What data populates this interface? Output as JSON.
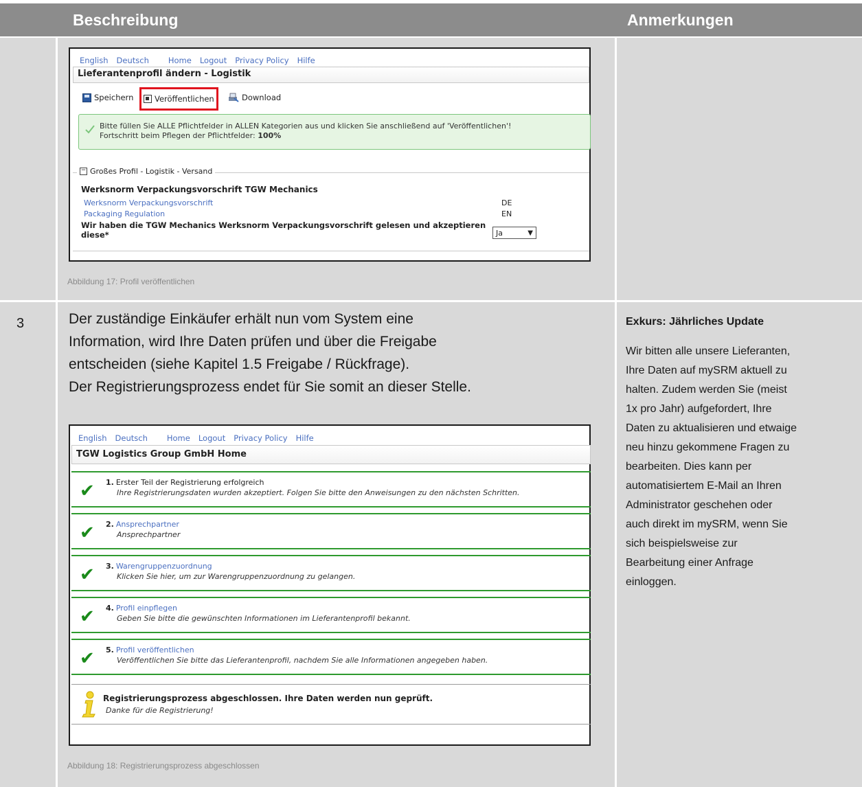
{
  "header": {
    "col_description": "Beschreibung",
    "col_notes": "Anmerkungen"
  },
  "figure17": {
    "nav": [
      "English",
      "Deutsch",
      "Home",
      "Logout",
      "Privacy Policy",
      "Hilfe"
    ],
    "title": "Lieferantenprofil ändern - Logistik",
    "toolbar": {
      "save": "Speichern",
      "publish": "Veröffentlichen",
      "download": "Download"
    },
    "message_line1": "Bitte füllen Sie ALLE Pflichtfelder in ALLEN Kategorien aus und klicken Sie anschließend auf 'Veröffentlichen'!",
    "message_line2_prefix": "Fortschritt beim Pflegen der Pflichtfelder:",
    "message_progress": "100%",
    "section_legend": "Großes Profil - Logistik - Versand",
    "section_title": "Werksnorm Verpackungsvorschrift TGW Mechanics",
    "link1": "Werksnorm Verpackungsvorschrift",
    "link1_lang": "DE",
    "link2": "Packaging Regulation",
    "link2_lang": "EN",
    "question": "Wir haben die TGW Mechanics Werksnorm Verpackungsvorschrift gelesen und akzeptieren diese*",
    "answer": "Ja",
    "caption": "Abbildung 17: Profil veröffentlichen"
  },
  "row3": {
    "number": "3",
    "text_line1": "Der zuständige Einkäufer erhält nun vom System eine",
    "text_line2": "Information, wird Ihre Daten prüfen und über die Freigabe",
    "text_line3": "entscheiden (siehe Kapitel 1.5 Freigabe / Rückfrage).",
    "text_line4": "Der Registrierungsprozess endet für Sie somit an dieser Stelle.",
    "note_title": "Exkurs: Jährliches Update",
    "note_lines": [
      "Wir bitten alle unsere Lieferanten,",
      "Ihre Daten auf mySRM aktuell zu",
      "halten. Zudem werden Sie (meist",
      "1x pro Jahr) aufgefordert, Ihre",
      "Daten zu aktualisieren und etwaige",
      "neu hinzu gekommene Fragen zu",
      "bearbeiten. Dies kann per",
      "automatisiertem E-Mail an Ihren",
      "Administrator geschehen oder",
      "auch direkt im mySRM, wenn Sie",
      "sich beispielsweise zur",
      "Bearbeitung einer Anfrage",
      "einloggen."
    ]
  },
  "figure18": {
    "nav": [
      "English",
      "Deutsch",
      "Home",
      "Logout",
      "Privacy Policy",
      "Hilfe"
    ],
    "title": "TGW Logistics Group GmbH Home",
    "steps": [
      {
        "num": "1.",
        "title": "Erster Teil der Registrierung erfolgreich",
        "desc": "Ihre Registrierungsdaten wurden akzeptiert. Folgen Sie bitte den Anweisungen zu den nächsten Schritten."
      },
      {
        "num": "2.",
        "title": "Ansprechpartner",
        "desc": "Ansprechpartner"
      },
      {
        "num": "3.",
        "title": "Warengruppenzuordnung",
        "desc": "Klicken Sie hier, um zur Warengruppenzuordnung zu gelangen."
      },
      {
        "num": "4.",
        "title": "Profil einpflegen",
        "desc": "Geben Sie bitte die gewünschten Informationen im Lieferantenprofil bekannt."
      },
      {
        "num": "5.",
        "title": "Profil veröffentlichen",
        "desc": "Veröffentlichen Sie bitte das Lieferantenprofil, nachdem Sie alle Informationen angegeben haben."
      }
    ],
    "final_title": "Registrierungsprozess abgeschlossen. Ihre Daten werden nun geprüft.",
    "final_desc": "Danke für die Registrierung!",
    "caption": "Abbildung 18: Registrierungsprozess abgeschlossen"
  }
}
